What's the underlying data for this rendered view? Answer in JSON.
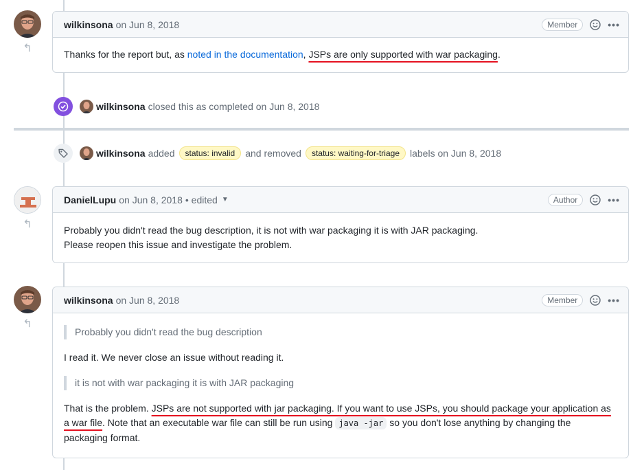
{
  "comments": [
    {
      "author": "wilkinsona",
      "date": "on Jun 8, 2018",
      "role": "Member",
      "body": {
        "pre": "Thanks for the report but, as ",
        "link": "noted in the documentation",
        "mid": ", ",
        "highlight": "JSPs are only supported with war packaging",
        "post": "."
      }
    },
    {
      "author": "DanielLupu",
      "date": "on Jun 8, 2018",
      "edited": "• edited",
      "role": "Author",
      "lines": [
        "Probably you didn't read the bug description, it is not with war packaging it is with JAR packaging.",
        "Please reopen this issue and investigate the problem."
      ]
    },
    {
      "author": "wilkinsona",
      "date": "on Jun 8, 2018",
      "role": "Member",
      "quote1": "Probably you didn't read the bug description",
      "text1": "I read it. We never close an issue without reading it.",
      "quote2": "it is not with war packaging it is with JAR packaging",
      "final_pre": "That is the problem. ",
      "final_highlight": "JSPs are not supported with jar packaging. If you want to use JSPs, you should package your application as a war file",
      "final_mid": ". Note that an executable war file can still be run using ",
      "final_code": "java -jar",
      "final_post": " so you don't lose anything by changing the packaging format."
    }
  ],
  "events": {
    "closed": {
      "actor": "wilkinsona",
      "text": "closed this as completed on Jun 8, 2018"
    },
    "labeled": {
      "actor": "wilkinsona",
      "added_text": "added",
      "added_label": "status: invalid",
      "removed_text": "and removed",
      "removed_label": "status: waiting-for-triage",
      "suffix": "labels on Jun 8, 2018"
    }
  },
  "icons": {
    "reply": "reply-arrow-icon",
    "emoji": "smiley-icon",
    "more": "kebab-horizontal-icon",
    "closed": "check-circle-icon",
    "label": "tag-icon"
  },
  "colors": {
    "closed_badge": "#8250df",
    "label_bg": "#fff8c5",
    "link": "#0969da",
    "annotation": "#e5101f"
  }
}
